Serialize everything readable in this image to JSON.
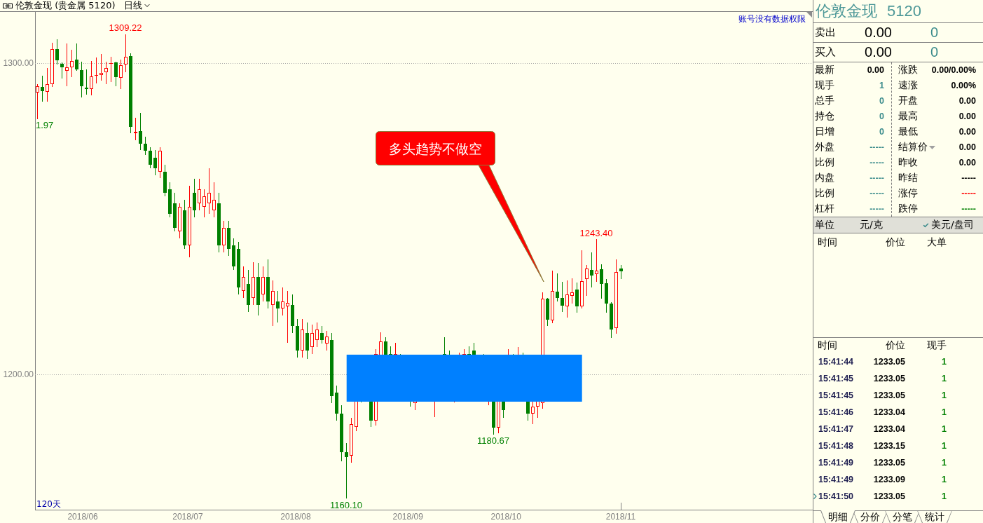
{
  "chart_header": {
    "instrument": "伦敦金现 (贵金属 5120)",
    "period": "日线"
  },
  "chart": {
    "notice": "账号没有数据权限",
    "y_axis_labels": [
      "1300.00",
      "1200.00"
    ],
    "price_labels": [
      {
        "kind": "high",
        "text": "1309.22"
      },
      {
        "kind": "low",
        "text": "1.97"
      },
      {
        "kind": "high",
        "text": "1243.40"
      },
      {
        "kind": "low",
        "text": "1180.67"
      },
      {
        "kind": "low",
        "text": "1160.10"
      }
    ],
    "callout": "多头趋势不做空",
    "period_label": "120天",
    "x_axis_labels": [
      "2018/06",
      "2018/07",
      "2018/08",
      "2018/09",
      "2018/10",
      "2018/11"
    ]
  },
  "quote_panel": {
    "title": {
      "name": "伦敦金现",
      "code": "5120"
    },
    "quotes": [
      {
        "label": "卖出",
        "price": "0.00",
        "volume": "0"
      },
      {
        "label": "买入",
        "price": "0.00",
        "volume": "0"
      }
    ],
    "stats_left": [
      {
        "label": "最新",
        "value": "0.00",
        "color": "#000000"
      },
      {
        "label": "现手",
        "value": "1",
        "color": "#3c8c8c"
      },
      {
        "label": "总手",
        "value": "0",
        "color": "#3c8c8c"
      },
      {
        "label": "持仓",
        "value": "0",
        "color": "#3c8c8c"
      },
      {
        "label": "日增",
        "value": "0",
        "color": "#3c8c8c"
      },
      {
        "label": "外盘",
        "value": "-----",
        "color": "#3c8c8c"
      },
      {
        "label": "比例",
        "value": "-----",
        "color": "#3c8c8c"
      },
      {
        "label": "内盘",
        "value": "-----",
        "color": "#3c8c8c"
      },
      {
        "label": "比例",
        "value": "-----",
        "color": "#3c8c8c"
      },
      {
        "label": "杠杆",
        "value": "-----",
        "color": "#3c8c8c"
      }
    ],
    "stats_right": [
      {
        "label": "涨跌",
        "value": "0.00/0.00%",
        "color": "#000000",
        "dropdown": false
      },
      {
        "label": "速涨",
        "value": "0.00%",
        "color": "#000000",
        "dropdown": false
      },
      {
        "label": "开盘",
        "value": "0.00",
        "color": "#000000",
        "dropdown": false
      },
      {
        "label": "最高",
        "value": "0.00",
        "color": "#000000",
        "dropdown": false
      },
      {
        "label": "最低",
        "value": "0.00",
        "color": "#000000",
        "dropdown": false
      },
      {
        "label": "结算价",
        "value": "0.00",
        "color": "#000000",
        "dropdown": true
      },
      {
        "label": "昨收",
        "value": "0.00",
        "color": "#000000",
        "dropdown": false
      },
      {
        "label": "昨结",
        "value": "-----",
        "color": "#000000",
        "dropdown": false
      },
      {
        "label": "涨停",
        "value": "-----",
        "color": "#ff0000",
        "dropdown": false
      },
      {
        "label": "跌停",
        "value": "-----",
        "color": "#008000",
        "dropdown": false
      }
    ],
    "units": {
      "label": "单位",
      "options": [
        {
          "label": "元/克",
          "selected": false
        },
        {
          "label": "美元/盘司",
          "selected": true
        }
      ]
    },
    "big_orders": {
      "columns": [
        "时间",
        "价位",
        "大单"
      ]
    },
    "trades": {
      "columns": [
        "时间",
        "价位",
        "现手"
      ],
      "rows": [
        {
          "time": "15:41:44",
          "price": "1233.05",
          "volume": "1",
          "current": false
        },
        {
          "time": "15:41:45",
          "price": "1233.05",
          "volume": "1",
          "current": false
        },
        {
          "time": "15:41:45",
          "price": "1233.05",
          "volume": "1",
          "current": false
        },
        {
          "time": "15:41:46",
          "price": "1233.04",
          "volume": "1",
          "current": false
        },
        {
          "time": "15:41:47",
          "price": "1233.04",
          "volume": "1",
          "current": false
        },
        {
          "time": "15:41:48",
          "price": "1233.15",
          "volume": "1",
          "current": false
        },
        {
          "time": "15:41:49",
          "price": "1233.05",
          "volume": "1",
          "current": false
        },
        {
          "time": "15:41:49",
          "price": "1233.09",
          "volume": "1",
          "current": false
        },
        {
          "time": "15:41:50",
          "price": "1233.05",
          "volume": "1",
          "current": true
        }
      ]
    },
    "tabs": [
      {
        "label": "明细",
        "selected": true
      },
      {
        "label": "分价",
        "selected": false
      },
      {
        "label": "分笔",
        "selected": false
      },
      {
        "label": "统计",
        "selected": false
      }
    ]
  }
}
